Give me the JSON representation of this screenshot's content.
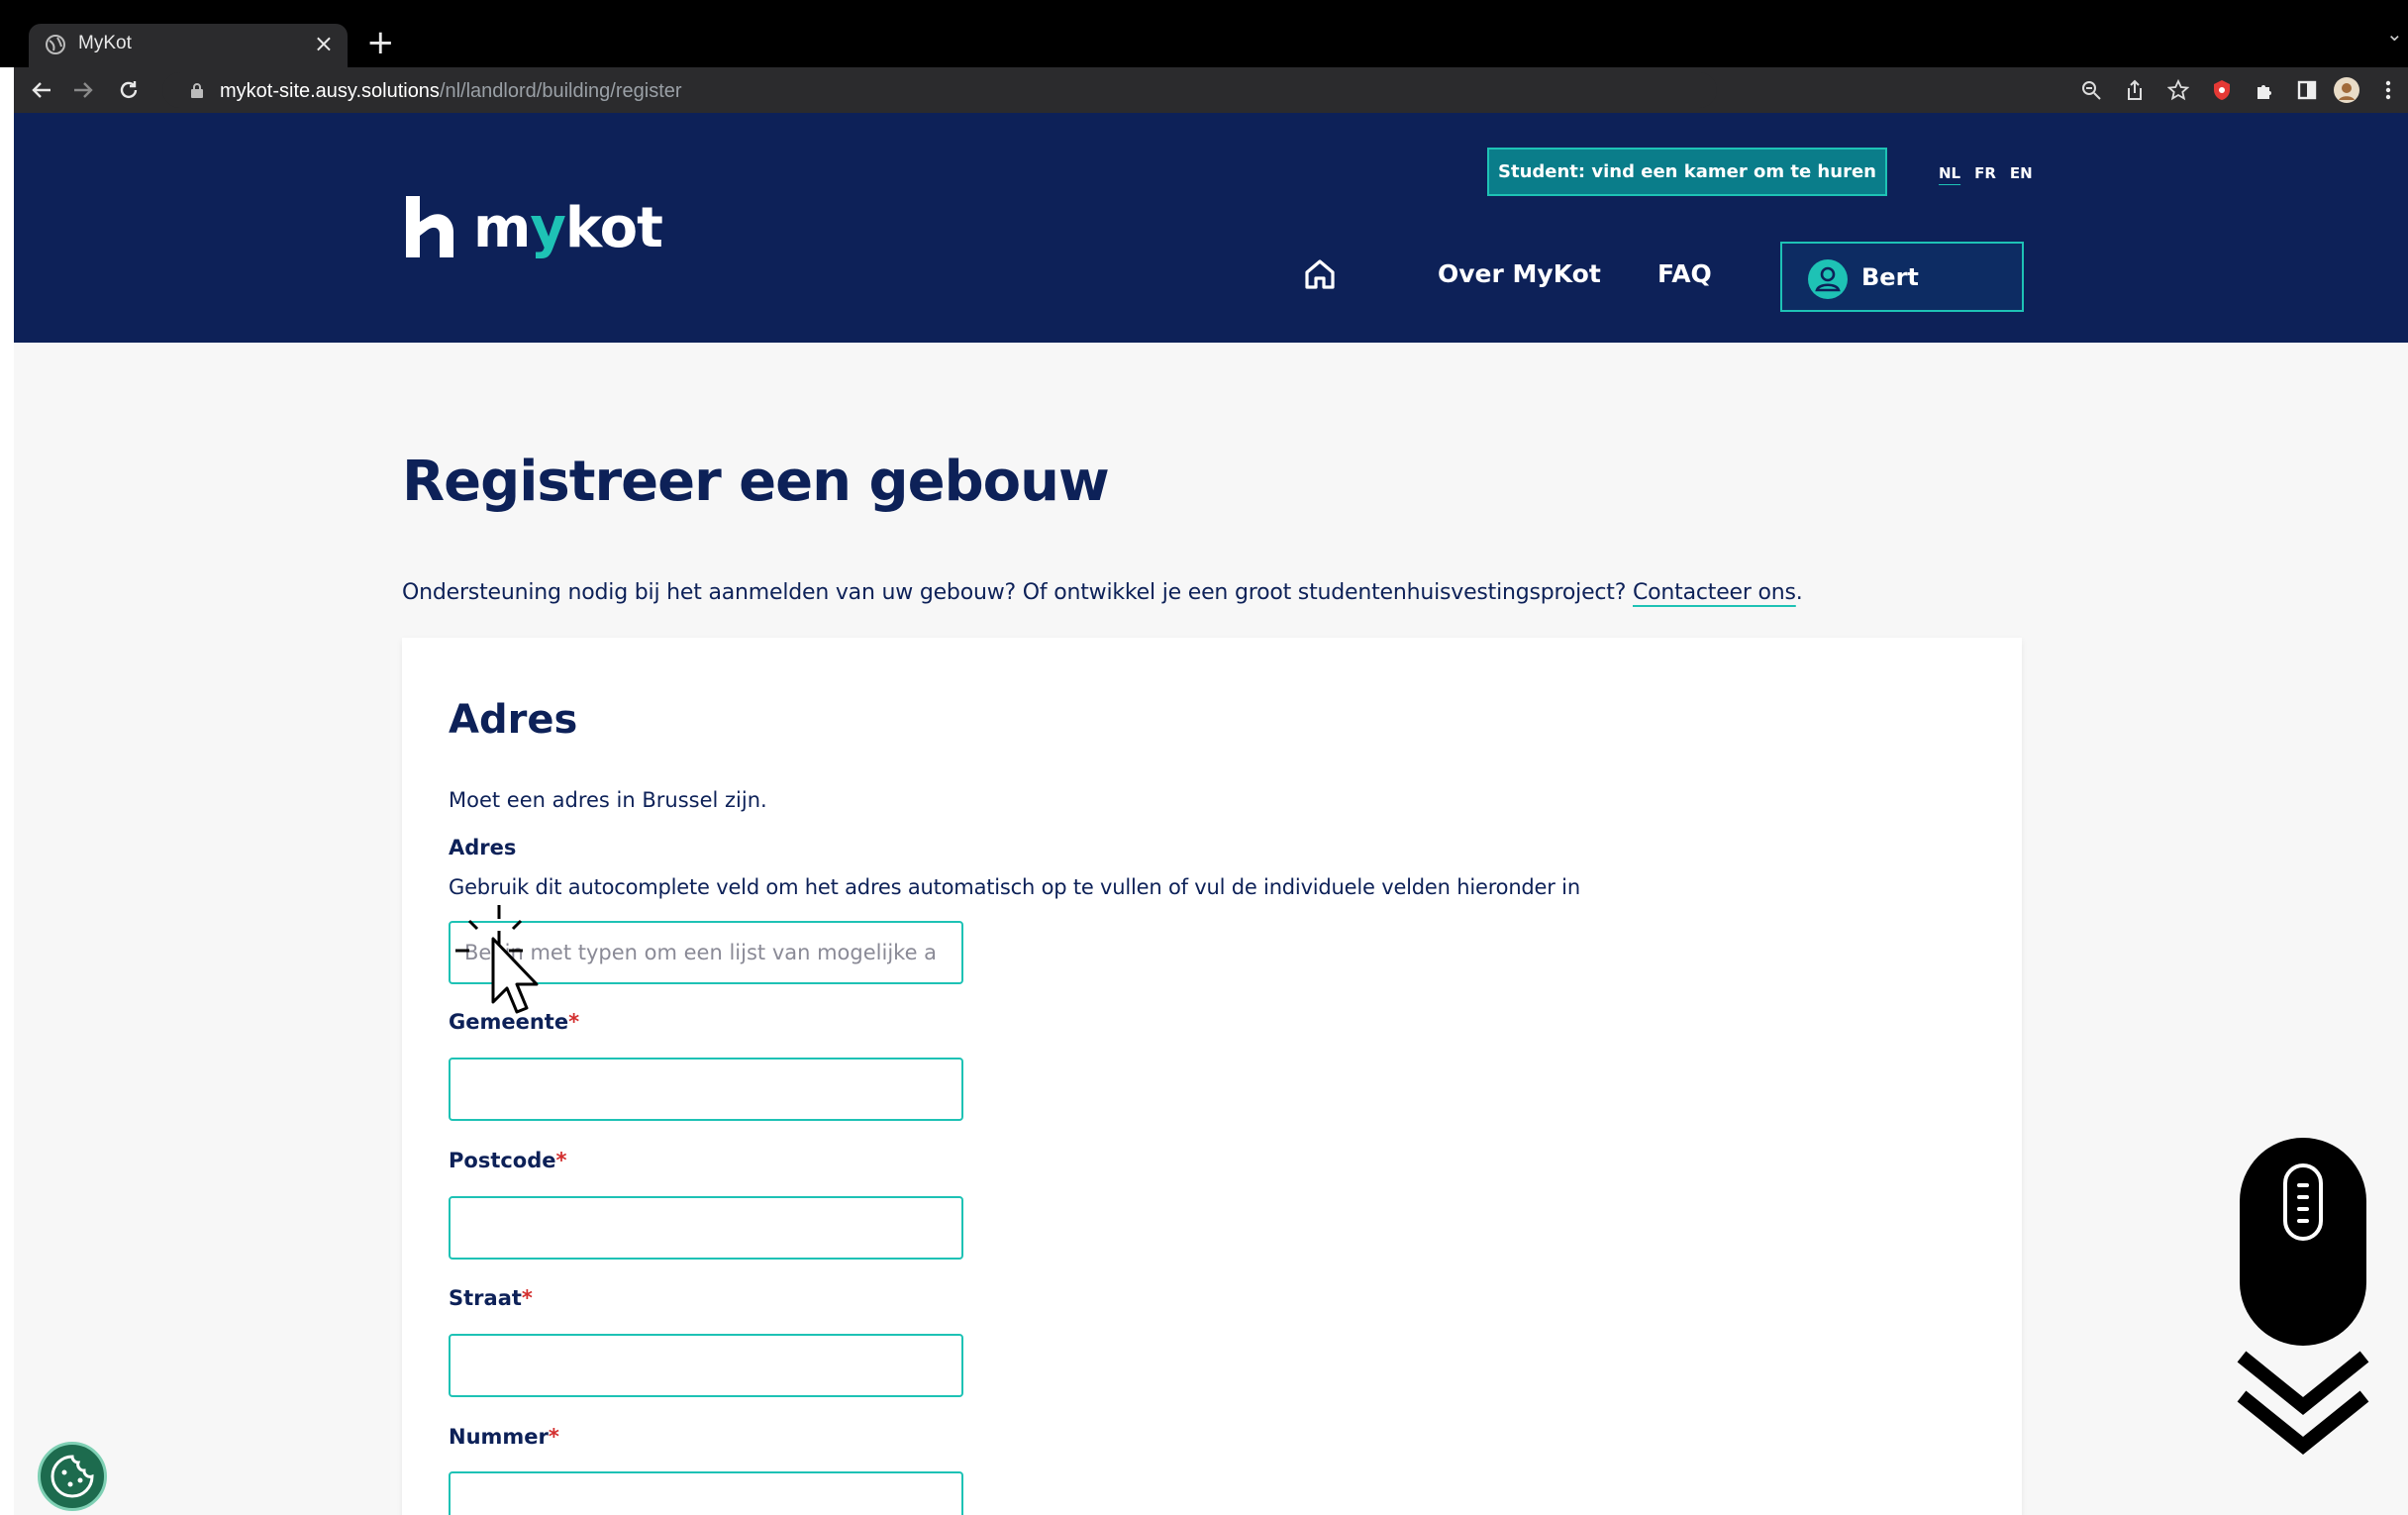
{
  "browser": {
    "tab_title": "MyKot",
    "tab_close": "×",
    "new_tab": "+",
    "url_host": "mykot-site.ausy.solutions",
    "url_path": "/nl/landlord/building/register",
    "icons": [
      "back-arrow-icon",
      "forward-arrow-icon",
      "reload-icon",
      "lock-icon",
      "zoom-icon",
      "share-icon",
      "star-icon",
      "extension-icon",
      "puzzle-icon",
      "sidebar-icon",
      "profile-icon",
      "menu-icon"
    ]
  },
  "header": {
    "logo_text_pre": "m",
    "logo_text_y": "y",
    "logo_text_post": "kot",
    "student_button": "Student: vind een kamer om te huren",
    "languages": [
      "NL",
      "FR",
      "EN"
    ],
    "active_language": "NL",
    "nav": {
      "about": "Over MyKot",
      "faq": "FAQ"
    },
    "user_name": "Bert"
  },
  "main": {
    "title": "Registreer een gebouw",
    "intro_text": "Ondersteuning nodig bij het aanmelden van uw gebouw? Of ontwikkel je een groot studentenhuisvestingsproject? ",
    "intro_link": "Contacteer ons",
    "intro_end": "."
  },
  "form": {
    "section_title": "Adres",
    "section_subtitle": "Moet een adres in Brussel zijn.",
    "autocomplete_label": "Adres",
    "autocomplete_help": "Gebruik dit autocomplete veld om het adres automatisch op te vullen of vul de individuele velden hieronder in",
    "autocomplete_placeholder": "Begin met typen om een lijst van mogelijke a",
    "fields": {
      "gemeente": {
        "label": "Gemeente",
        "required": "*",
        "value": ""
      },
      "postcode": {
        "label": "Postcode",
        "required": "*",
        "value": ""
      },
      "straat": {
        "label": "Straat",
        "required": "*",
        "value": ""
      },
      "nummer": {
        "label": "Nummer",
        "required": "*",
        "value": ""
      }
    }
  },
  "colors": {
    "navy": "#0d2158",
    "teal": "#1ec2b5",
    "required": "#d32f2f"
  }
}
